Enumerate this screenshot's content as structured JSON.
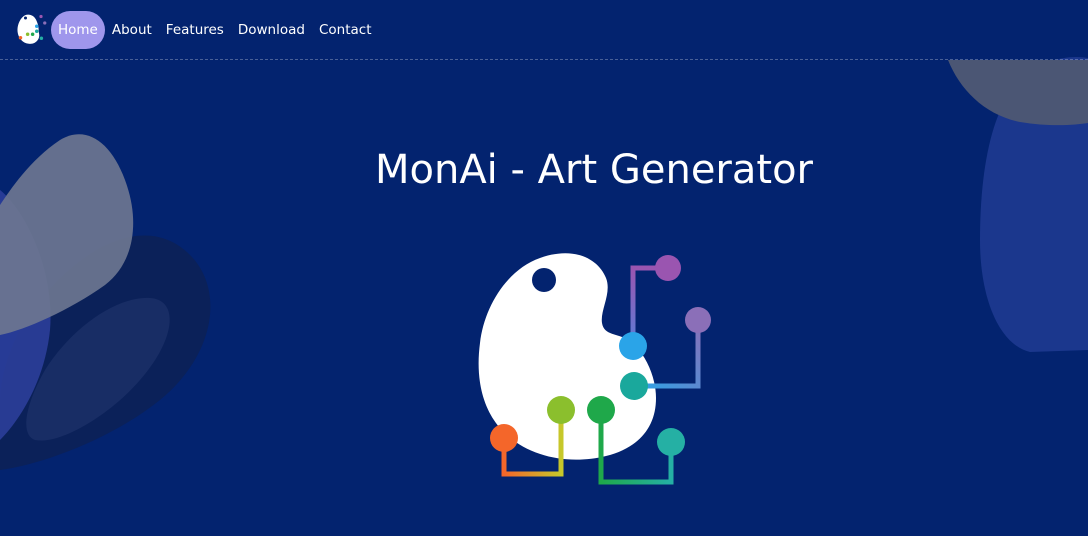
{
  "nav": {
    "logo_icon": "palette-circuit-logo-icon",
    "items": [
      {
        "label": "Home",
        "active": true
      },
      {
        "label": "About",
        "active": false
      },
      {
        "label": "Features",
        "active": false
      },
      {
        "label": "Download",
        "active": false
      },
      {
        "label": "Contact",
        "active": false
      }
    ]
  },
  "hero": {
    "title": "MonAi - Art Generator",
    "logo_icon": "palette-circuit-logo-icon"
  },
  "colors": {
    "background": "#03236f",
    "active_pill": "#9f96ec",
    "text": "#ffffff"
  }
}
